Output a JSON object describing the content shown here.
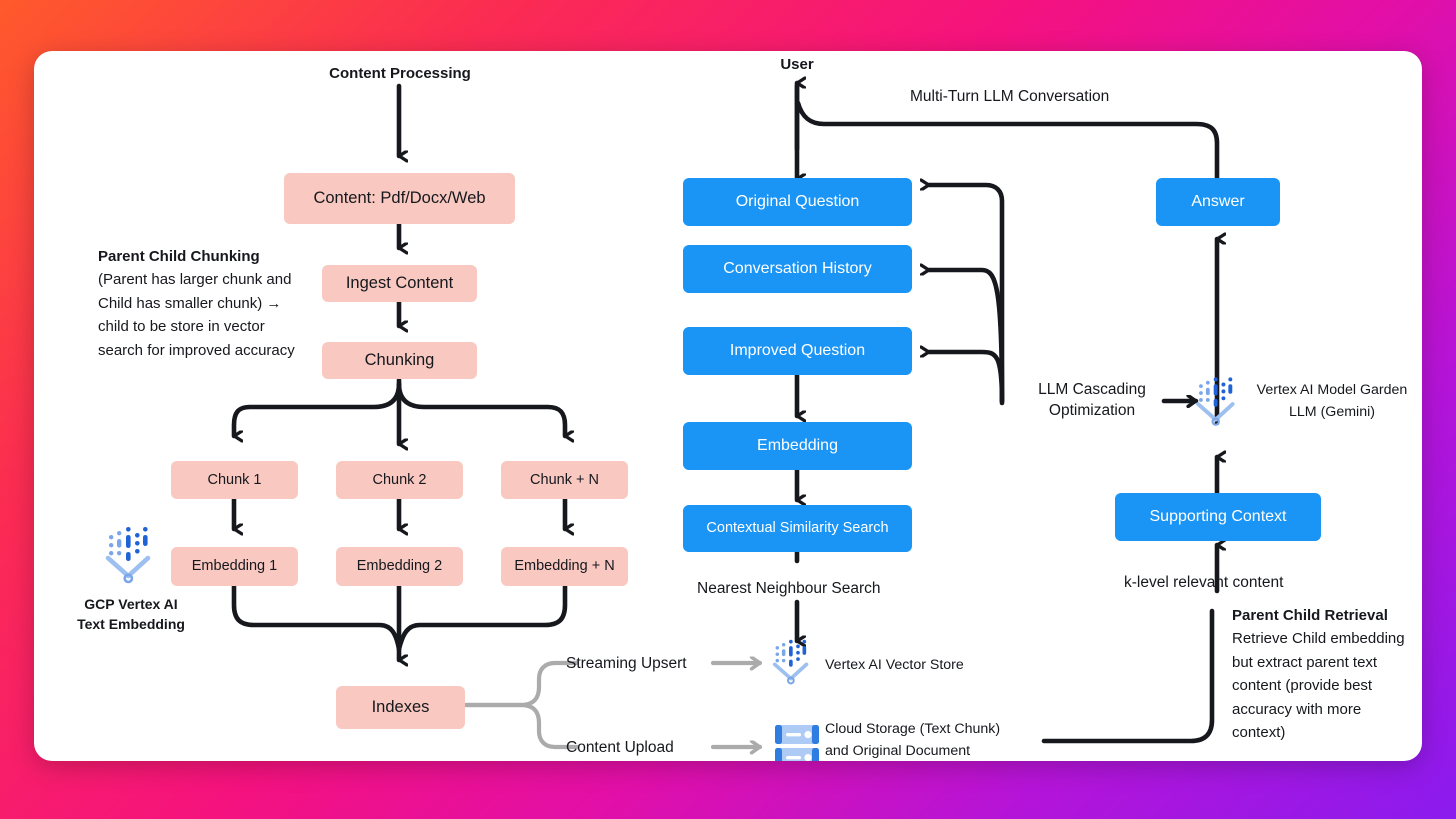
{
  "theme": {
    "pink_box": "#F8C8C1",
    "blue_box": "#1A94F5",
    "arrow_black": "#16181d",
    "arrow_grey": "#ABABAB",
    "card_bg": "#FFFFFF",
    "gradient_start": "#FF5A2B",
    "gradient_mid": "#F5127E",
    "gradient_end": "#8B1BEE"
  },
  "ingestion": {
    "section_title": "Content Processing",
    "nodes": {
      "content": "Content: Pdf/Docx/Web",
      "ingest": "Ingest Content",
      "chunking": "Chunking",
      "chunk1": "Chunk 1",
      "chunk2": "Chunk 2",
      "chunkn": "Chunk + N",
      "embedding1": "Embedding 1",
      "embedding2": "Embedding 2",
      "embeddingn": "Embedding + N",
      "indexes": "Indexes"
    },
    "note": {
      "title": "Parent Child Chunking",
      "body": "(Parent has larger chunk and Child has smaller chunk) → child to be store in vector search for improved accuracy"
    },
    "embedding_service": {
      "icon": "vertex-ai-icon",
      "line1": "GCP Vertex AI",
      "line2": "Text Embedding"
    },
    "branches": [
      {
        "label": "Streaming Upsert",
        "target_icon": "vertex-ai-icon",
        "target": "Vertex AI Vector Store"
      },
      {
        "label": "Content Upload",
        "target_icon": "cloud-storage-icon",
        "target_line1": "Cloud Storage (Text Chunk)",
        "target_line2": "and Original Document"
      }
    ]
  },
  "query_flow": {
    "user_label": "User",
    "conversation_label": "Multi-Turn LLM Conversation",
    "nodes": {
      "original_question": "Original Question",
      "conversation_history": "Conversation History",
      "improved_question": "Improved Question",
      "embedding": "Embedding",
      "similarity_search": "Contextual Similarity Search"
    },
    "nearest_neighbour_label": "Nearest Neighbour Search"
  },
  "generation": {
    "nodes": {
      "answer": "Answer",
      "supporting_context": "Supporting Context"
    },
    "cascading_label_line1": "LLM Cascading",
    "cascading_label_line2": "Optimization",
    "model_garden": {
      "icon": "vertex-ai-icon",
      "line1": "Vertex AI Model Garden",
      "line2": "LLM (Gemini)"
    },
    "k_level_label": "k-level relevant content",
    "note": {
      "title": "Parent Child Retrieval",
      "body": "Retrieve Child embedding but extract parent text content (provide best accuracy with more context)"
    }
  }
}
